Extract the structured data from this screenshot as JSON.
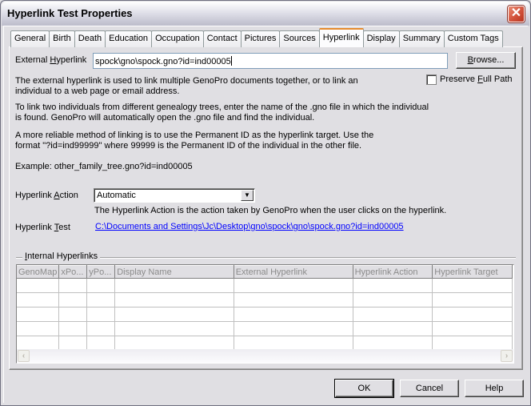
{
  "window": {
    "title": "Hyperlink Test Properties",
    "close_icon": "close-icon"
  },
  "tabs": [
    {
      "label": "General",
      "active": false
    },
    {
      "label": "Birth",
      "active": false
    },
    {
      "label": "Death",
      "active": false
    },
    {
      "label": "Education",
      "active": false
    },
    {
      "label": "Occupation",
      "active": false
    },
    {
      "label": "Contact",
      "active": false
    },
    {
      "label": "Pictures",
      "active": false
    },
    {
      "label": "Sources",
      "active": false
    },
    {
      "label": "Hyperlink",
      "active": true
    },
    {
      "label": "Display",
      "active": false
    },
    {
      "label": "Summary",
      "active": false
    },
    {
      "label": "Custom Tags",
      "active": false
    }
  ],
  "external_hyperlink": {
    "label_pre": "External ",
    "label_accel": "H",
    "label_post": "yperlink",
    "value": "spock\\gno\\spock.gno?id=ind00005",
    "browse_accel": "B",
    "browse_rest": "rowse..."
  },
  "preserve_full_path": {
    "label_pre": "Preserve ",
    "label_accel": "F",
    "label_post": "ull Path",
    "checked": false
  },
  "help_text": {
    "p1_line1": "The external hyperlink is used to link multiple GenoPro documents together, or to link an",
    "p1_line2": "individual to a web page or email address.",
    "p2_line1": "To link two individuals from different genealogy trees, enter the name of the .gno file in which the individual",
    "p2_line2": "is found.  GenoPro will automatically open the .gno file and find the individual.",
    "p3_line1": "A more reliable method of linking is to use the Permanent ID as the hyperlink target.  Use the",
    "p3_line2": "format \"?id=ind99999\" where 99999 is the Permanent ID of the individual in the other file.",
    "example": "Example: other_family_tree.gno?id=ind00005"
  },
  "hyperlink_action": {
    "label_pre": "Hyperlink ",
    "label_accel": "A",
    "label_post": "ction",
    "selected": "Automatic",
    "description": "The Hyperlink Action is the action taken by GenoPro when the user clicks on the hyperlink."
  },
  "hyperlink_test": {
    "label_pre": "Hyperlink ",
    "label_accel": "T",
    "label_post": "est",
    "link": "C:\\Documents and Settings\\Jc\\Desktop\\gno\\spock\\gno\\spock.gno?id=ind00005"
  },
  "internal_hyperlinks": {
    "legend_accel": "I",
    "legend_rest": "nternal Hyperlinks",
    "columns": [
      "GenoMap",
      "xPo...",
      "yPo...",
      "Display Name",
      "External Hyperlink",
      "Hyperlink Action",
      "Hyperlink Target"
    ],
    "row_count": 5
  },
  "footer": {
    "ok": "OK",
    "cancel": "Cancel",
    "help": "Help"
  }
}
